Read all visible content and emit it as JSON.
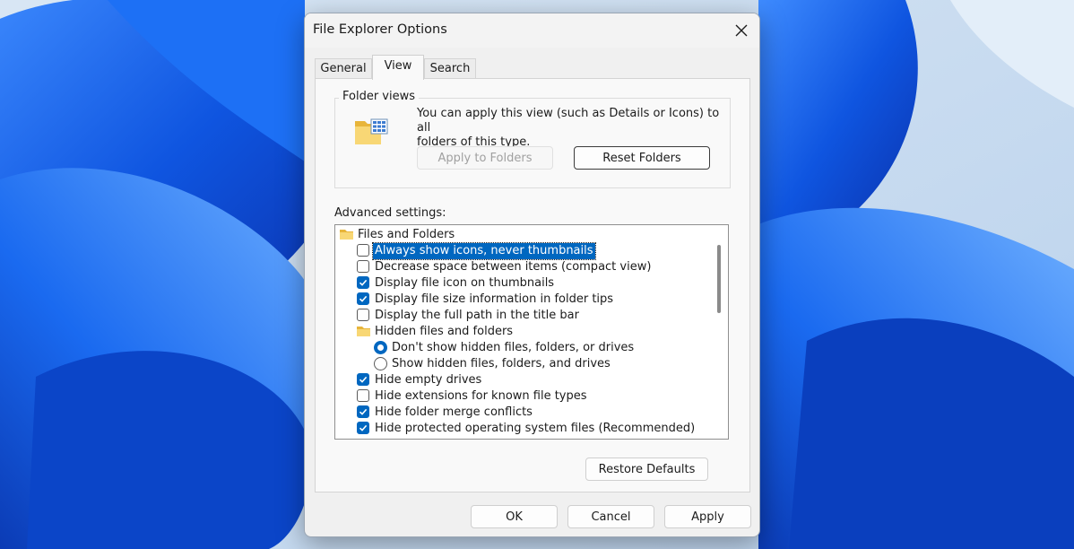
{
  "dialog": {
    "title": "File Explorer Options"
  },
  "tabs": [
    {
      "label": "General",
      "active": false
    },
    {
      "label": "View",
      "active": true
    },
    {
      "label": "Search",
      "active": false
    }
  ],
  "folder_views": {
    "label": "Folder views",
    "description_line1": "You can apply this view (such as Details or Icons) to all",
    "description_line2": "folders of this type.",
    "apply_button": "Apply to Folders",
    "reset_button": "Reset Folders"
  },
  "advanced": {
    "label": "Advanced settings:",
    "items": [
      {
        "type": "folder",
        "label": "Files and Folders",
        "indent": 0
      },
      {
        "type": "checkbox",
        "label": "Always show icons, never thumbnails",
        "checked": false,
        "selected": true,
        "indent": 1
      },
      {
        "type": "checkbox",
        "label": "Decrease space between items (compact view)",
        "checked": false,
        "indent": 1
      },
      {
        "type": "checkbox",
        "label": "Display file icon on thumbnails",
        "checked": true,
        "indent": 1
      },
      {
        "type": "checkbox",
        "label": "Display file size information in folder tips",
        "checked": true,
        "indent": 1
      },
      {
        "type": "checkbox",
        "label": "Display the full path in the title bar",
        "checked": false,
        "indent": 1
      },
      {
        "type": "folder",
        "label": "Hidden files and folders",
        "indent": 1
      },
      {
        "type": "radio",
        "label": "Don't show hidden files, folders, or drives",
        "checked": true,
        "indent": 2
      },
      {
        "type": "radio",
        "label": "Show hidden files, folders, and drives",
        "checked": false,
        "indent": 2
      },
      {
        "type": "checkbox",
        "label": "Hide empty drives",
        "checked": true,
        "indent": 1
      },
      {
        "type": "checkbox",
        "label": "Hide extensions for known file types",
        "checked": false,
        "indent": 1
      },
      {
        "type": "checkbox",
        "label": "Hide folder merge conflicts",
        "checked": true,
        "indent": 1
      },
      {
        "type": "checkbox",
        "label": "Hide protected operating system files (Recommended)",
        "checked": true,
        "indent": 1
      }
    ],
    "restore_button": "Restore Defaults"
  },
  "footer": {
    "ok": "OK",
    "cancel": "Cancel",
    "apply": "Apply"
  },
  "colors": {
    "accent": "#0067c0",
    "wallpaper_bg": "#cfe0f2",
    "wallpaper_blue": "#1460e0"
  }
}
